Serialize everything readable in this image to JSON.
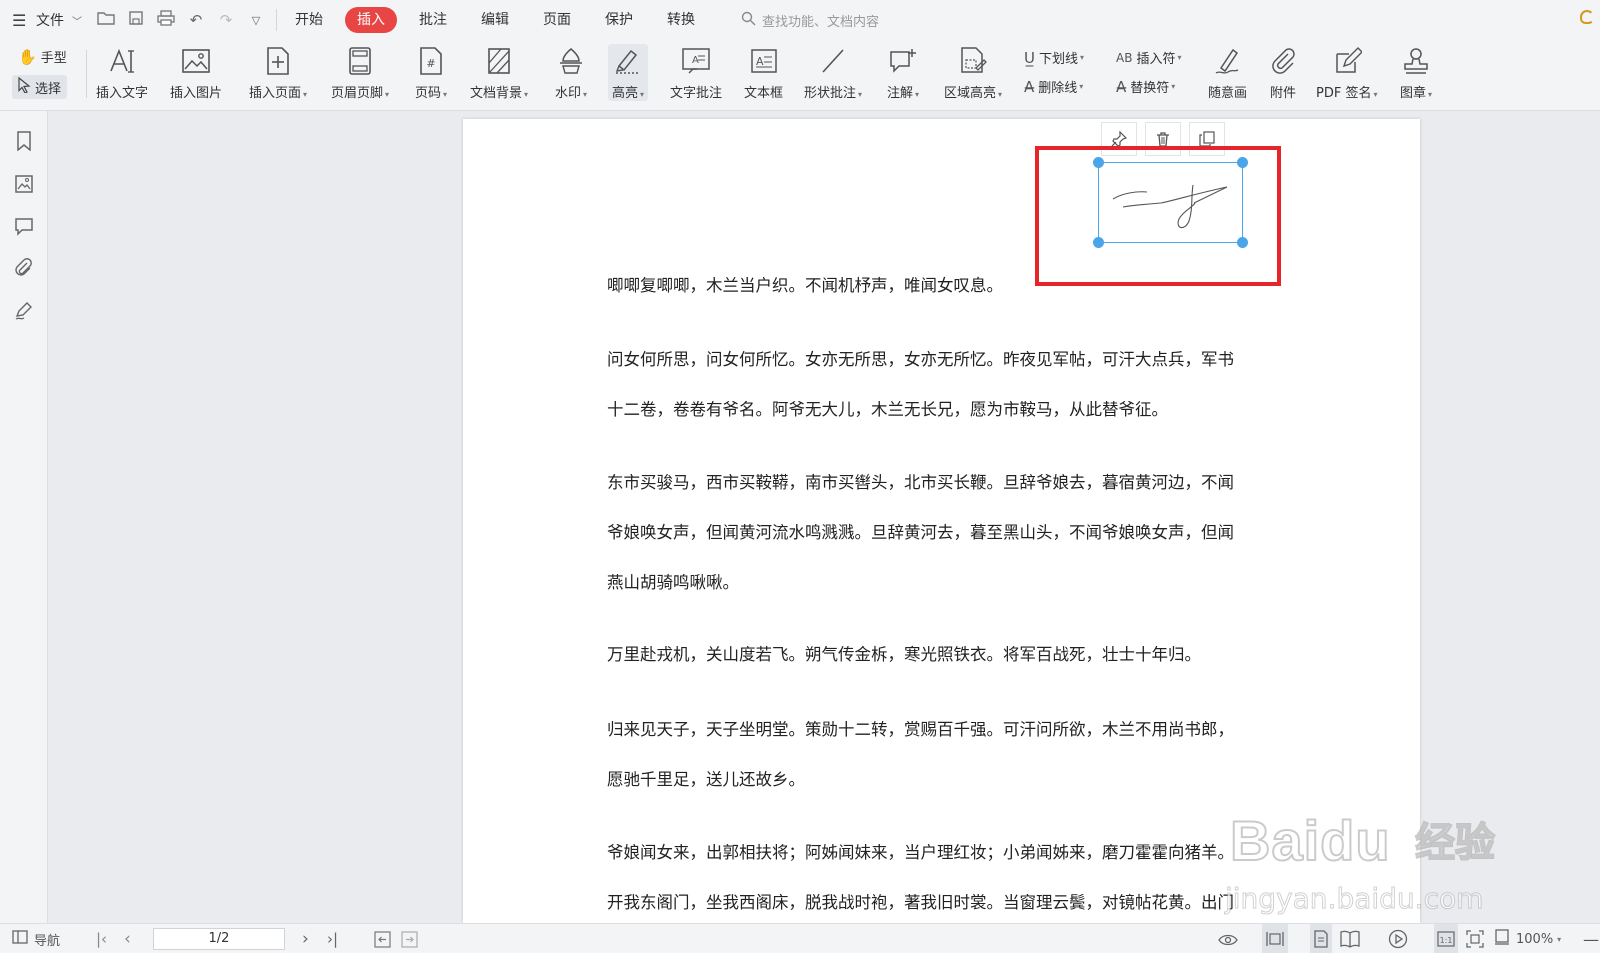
{
  "menubar": {
    "file_label": "文件",
    "tabs": [
      "开始",
      "插入",
      "批注",
      "编辑",
      "页面",
      "保护",
      "转换"
    ],
    "active_tab": "插入",
    "search_placeholder": "查找功能、文档内容"
  },
  "ribbon": {
    "hand_label": "手型",
    "select_label": "选择",
    "buttons": [
      {
        "label": "插入文字",
        "icon": "insert-text-icon"
      },
      {
        "label": "插入图片",
        "icon": "insert-image-icon"
      },
      {
        "label": "插入页面",
        "icon": "insert-page-icon"
      },
      {
        "label": "页眉页脚",
        "icon": "header-footer-icon"
      },
      {
        "label": "页码",
        "icon": "page-number-icon"
      },
      {
        "label": "文档背景",
        "icon": "doc-background-icon"
      },
      {
        "label": "水印",
        "icon": "watermark-icon"
      },
      {
        "label": "高亮",
        "icon": "highlight-icon"
      },
      {
        "label": "文字批注",
        "icon": "text-annotation-icon"
      },
      {
        "label": "文本框",
        "icon": "textbox-icon"
      },
      {
        "label": "形状批注",
        "icon": "shape-annotation-icon"
      },
      {
        "label": "注解",
        "icon": "note-icon"
      },
      {
        "label": "区域高亮",
        "icon": "area-highlight-icon"
      },
      {
        "label": "随意画",
        "icon": "freehand-icon"
      },
      {
        "label": "附件",
        "icon": "attachment-icon"
      },
      {
        "label": "PDF 签名",
        "icon": "pdf-sign-icon"
      },
      {
        "label": "图章",
        "icon": "stamp-icon"
      }
    ],
    "underline_label": "下划线",
    "strikethrough_label": "删除线",
    "insert_symbol_label": "插入符",
    "replace_symbol_label": "替换符"
  },
  "document": {
    "paragraphs": [
      [
        "唧唧复唧唧，木兰当户织。不闻机杼声，唯闻女叹息。"
      ],
      [
        "问女何所思，问女何所忆。女亦无所思，女亦无所忆。昨夜见军帖，可汗大点兵，军书",
        "十二卷，卷卷有爷名。阿爷无大儿，木兰无长兄，愿为市鞍马，从此替爷征。"
      ],
      [
        "东市买骏马，西市买鞍鞯，南市买辔头，北市买长鞭。旦辞爷娘去，暮宿黄河边，不闻",
        "爷娘唤女声，但闻黄河流水鸣溅溅。旦辞黄河去，暮至黑山头，不闻爷娘唤女声，但闻",
        "燕山胡骑鸣啾啾。"
      ],
      [
        "万里赴戎机，关山度若飞。朔气传金柝，寒光照铁衣。将军百战死，壮士十年归。"
      ],
      [
        "归来见天子，天子坐明堂。策勋十二转，赏赐百千强。可汗问所欲，木兰不用尚书郎，",
        "愿驰千里足，送儿还故乡。"
      ],
      [
        "爷娘闻女来，出郭相扶将；阿姊闻妹来，当户理红妆；小弟闻姊来，磨刀霍霍向猪羊。",
        "开我东阁门，坐我西阁床，脱我战时袍，著我旧时裳。当窗理云鬓，对镜帖花黄。出门"
      ]
    ]
  },
  "watermark": {
    "brand": "Baidu",
    "brand_cn": "经验",
    "url": "jingyan.baidu.com"
  },
  "statusbar": {
    "nav_label": "导航",
    "page_indicator": "1/2",
    "zoom": "100%"
  },
  "colors": {
    "active_tab_bg": "#e84545",
    "selection_frame": "#e5252a",
    "handle": "#4aa5ea"
  }
}
